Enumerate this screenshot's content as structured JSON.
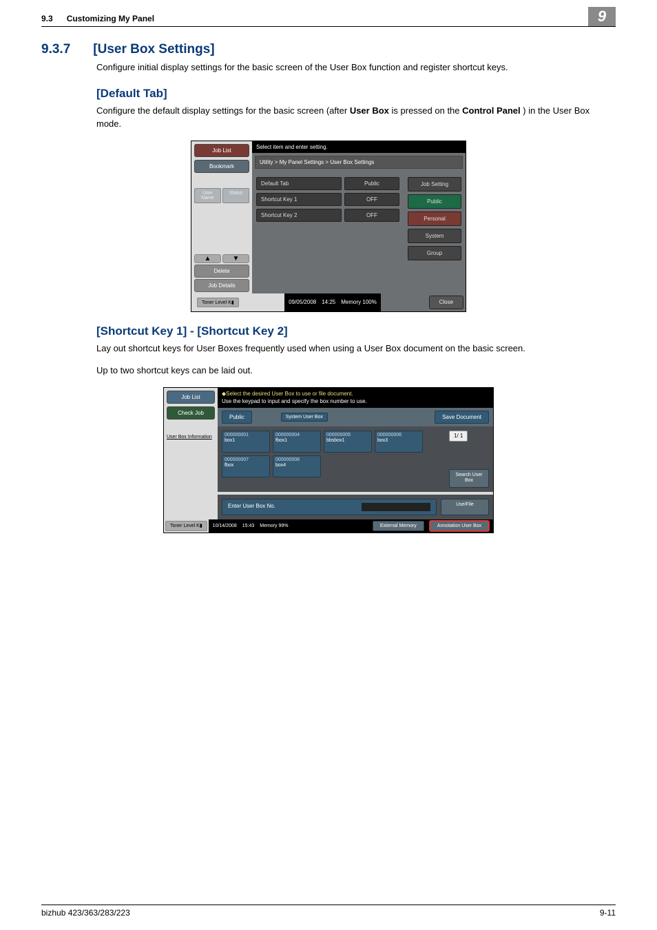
{
  "header": {
    "sec": "9.3",
    "secname": "Customizing My Panel",
    "badge": "9"
  },
  "s937": {
    "num": "9.3.7",
    "title": "[User Box Settings]",
    "intro": "Configure initial display settings for the basic screen of the User Box function and register shortcut keys."
  },
  "default_tab": {
    "title": "[Default Tab]",
    "body_before": "Configure the default display settings for the basic screen (after ",
    "bold1": "User Box",
    "body_mid": " is pressed on the ",
    "bold2": "Control Panel",
    "body_after": ") in the User Box mode."
  },
  "dev1": {
    "jobList": "Job List",
    "bookmark": "Bookmark",
    "userName": "User Name",
    "status": "Status",
    "delete": "Delete",
    "jobDetails": "Job Details",
    "tonerLevel": "Toner Level",
    "msg": "Select item and enter setting.",
    "crumb": "Utility > My Panel Settings > User Box Settings",
    "rows": [
      {
        "k": "Default Tab",
        "v": "Public"
      },
      {
        "k": "Shortcut Key 1",
        "v": "OFF"
      },
      {
        "k": "Shortcut Key 2",
        "v": "OFF"
      }
    ],
    "right": {
      "jobSetting": "Job Setting",
      "public": "Public",
      "personal": "Personal",
      "system": "System",
      "group": "Group"
    },
    "date": "09/05/2008",
    "time": "14:25",
    "memLabel": "Memory",
    "mem": "100%",
    "close": "Close"
  },
  "shortcut": {
    "title": "[Shortcut Key 1] - [Shortcut Key 2]",
    "p1": "Lay out shortcut keys for User Boxes frequently used when using a User Box document on the basic screen.",
    "p2": "Up to two shortcut keys can be laid out."
  },
  "dev2": {
    "jobList": "Job List",
    "checkJob": "Check Job",
    "userBoxInfo": "User Box Information",
    "msg1": "Select the desired User Box to use or file document.",
    "msg2": "Use the keypad to input and specify the box number to use.",
    "tabs": {
      "public": "Public",
      "system": "System User Box",
      "save": "Save Document"
    },
    "boxes": [
      {
        "id": "000000001",
        "name": "box1"
      },
      {
        "id": "000000004",
        "name": "fbox1"
      },
      {
        "id": "000000005",
        "name": "bbsbox1"
      },
      {
        "id": "000000006",
        "name": "box3"
      },
      {
        "id": "000000007",
        "name": "fbox"
      },
      {
        "id": "000000008",
        "name": "box4"
      }
    ],
    "page": "1/ 1",
    "search": "Search User Box",
    "enterBoxNo": "Enter User Box No.",
    "useFile": "Use/File",
    "tonerLevel": "Toner Level",
    "date": "10/14/2008",
    "time": "15:43",
    "memLabel": "Memory",
    "mem": "99%",
    "extMem": "External Memory",
    "annot": "Annotation User Box"
  },
  "footer": {
    "left": "bizhub 423/363/283/223",
    "right": "9-11"
  }
}
